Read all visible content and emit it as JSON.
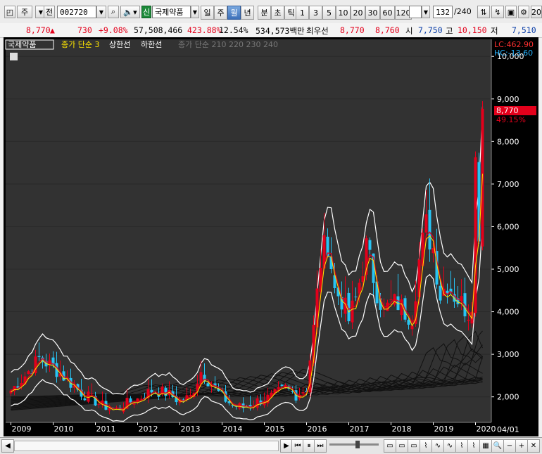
{
  "toolbar": {
    "market_type": "주",
    "prev_label": "전",
    "stock_code": "002720",
    "search_icon": "search-icon",
    "speaker_icon": "speaker-icon",
    "credit_badge": "신",
    "stock_name": "국제약품",
    "periods": [
      "일",
      "주",
      "월",
      "년",
      "분",
      "초",
      "틱"
    ],
    "selected_period": "월",
    "intervals": [
      "1",
      "3",
      "5",
      "10",
      "20",
      "30",
      "60",
      "120"
    ],
    "count": "132",
    "count_total": "/240",
    "extra": "20"
  },
  "info_bar": {
    "price": "8,770",
    "change_arrow": "▲",
    "change": "730",
    "change_pct": "+9.08%",
    "volume": "57,508,466",
    "volume_ratio": "423.88%",
    "turnover": "12.54%",
    "amount": "534,573백만",
    "best_bid_label": "최우선",
    "best_ask": "8,770",
    "best_bid": "8,760",
    "open_label": "시",
    "open": "7,750",
    "high_label": "고",
    "high": "10,150",
    "low_label": "저",
    "low": "7,510"
  },
  "legend": {
    "name": "국제약품",
    "ma_label": "종가 단순 3",
    "upper_label": "상한선",
    "lower_label": "하한선",
    "long_ma_label": "종가 단순 210  220  230  240"
  },
  "right_axis": {
    "lc_label": "LC:462.90",
    "hc_label": "HC:-13.60",
    "current_price_tag": "8,770",
    "current_pct": "49.15%",
    "ticks": [
      "10,000",
      "9,000",
      "8,000",
      "7,000",
      "6,000",
      "5,000",
      "4,000",
      "3,000",
      "2,000"
    ],
    "date_label": "04/01"
  },
  "colors": {
    "up": "#e3001b",
    "down": "#27c4f4",
    "ma": "#ffe600",
    "band": "#ffffff",
    "bg": "#000000",
    "grid": "#2a2a2a"
  },
  "chart_data": {
    "type": "candlestick",
    "x_labels": [
      "2009",
      "2010",
      "2011",
      "2012",
      "2013",
      "2014",
      "2015",
      "2016",
      "2017",
      "2018",
      "2019",
      "2020"
    ],
    "y_ticks": [
      2000,
      3000,
      4000,
      5000,
      6000,
      7000,
      8000,
      9000,
      10000
    ],
    "ylim": [
      1400,
      10400
    ],
    "last_close": 8770,
    "period": "monthly"
  }
}
